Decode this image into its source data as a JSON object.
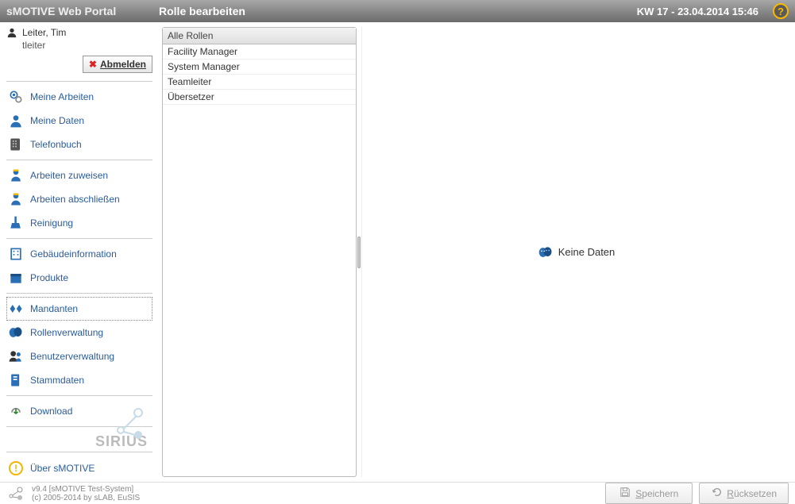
{
  "header": {
    "app_name": "sMOTIVE Web Portal",
    "page_title": "Rolle bearbeiten",
    "datetime": "KW 17 - 23.04.2014 15:46"
  },
  "user": {
    "display_name": "Leiter, Tim",
    "login": "tleiter",
    "logout_label": "Abmelden"
  },
  "nav": {
    "g1": [
      {
        "icon": "gear-icon",
        "label": "Meine Arbeiten"
      },
      {
        "icon": "person-icon",
        "label": "Meine Daten"
      },
      {
        "icon": "phonebook-icon",
        "label": "Telefonbuch"
      }
    ],
    "g2": [
      {
        "icon": "worker-assign-icon",
        "label": "Arbeiten zuweisen"
      },
      {
        "icon": "worker-done-icon",
        "label": "Arbeiten abschließen"
      },
      {
        "icon": "cleaning-icon",
        "label": "Reinigung"
      }
    ],
    "g3": [
      {
        "icon": "building-icon",
        "label": "Gebäudeinformation"
      },
      {
        "icon": "box-icon",
        "label": "Produkte"
      }
    ],
    "g4": [
      {
        "icon": "tenants-icon",
        "label": "Mandanten",
        "selected": true
      },
      {
        "icon": "roles-icon",
        "label": "Rollenverwaltung"
      },
      {
        "icon": "users-icon",
        "label": "Benutzerverwaltung"
      },
      {
        "icon": "masterdata-icon",
        "label": "Stammdaten"
      }
    ],
    "g5": [
      {
        "icon": "download-icon",
        "label": "Download"
      }
    ],
    "about_label": "Über sMOTIVE",
    "sirius": "SIRIUS"
  },
  "roles": {
    "header": "Alle Rollen",
    "items": [
      "Facility Manager",
      "System Manager",
      "Teamleiter",
      "Übersetzer"
    ]
  },
  "detail": {
    "nodata": "Keine Daten"
  },
  "footer": {
    "version": "v9.4 [sMOTIVE Test-System]",
    "copyright": "(c) 2005-2014 by sLAB, EuSIS",
    "save_label": "Speichern",
    "save_key": "S",
    "reset_label": "Rücksetzen",
    "reset_key": "R",
    "logo": "SIRIUS"
  }
}
